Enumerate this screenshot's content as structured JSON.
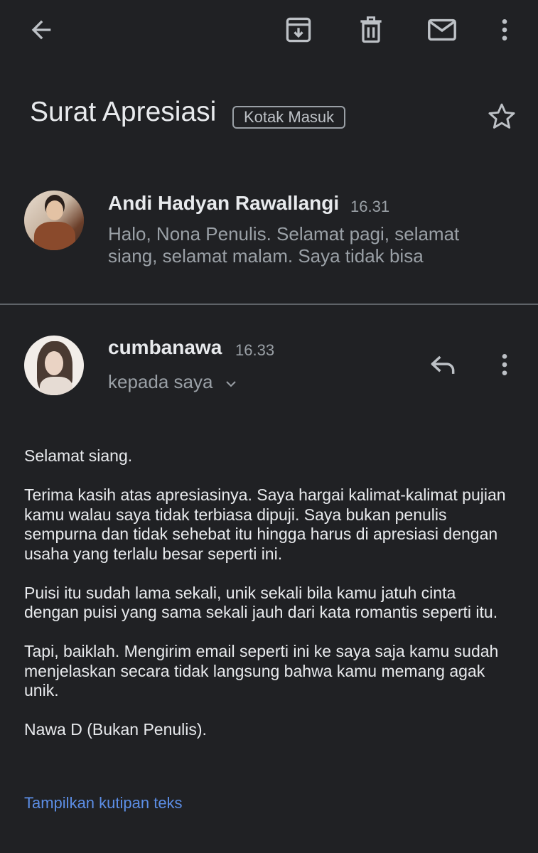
{
  "toolbar": {
    "back_icon": "arrow-back-icon",
    "archive_icon": "archive-icon",
    "delete_icon": "trash-icon",
    "mark_unread_icon": "mail-icon",
    "more_icon": "more-vert-icon"
  },
  "subject": {
    "title": "Surat Apresiasi",
    "label": "Kotak Masuk",
    "star_icon": "star-outline-icon"
  },
  "messages": [
    {
      "sender": "Andi Hadyan Rawallangi",
      "time": "16.31",
      "snippet": "Halo, Nona Penulis. Selamat pagi, selamat siang, selamat malam. Saya tidak bisa"
    },
    {
      "sender": "cumbanawa",
      "time": "16.33",
      "recipient": "kepada saya",
      "body": [
        "Selamat siang.",
        "Terima kasih atas apresiasinya. Saya hargai kalimat-kalimat pujian kamu walau saya tidak terbiasa dipuji. Saya bukan penulis sempurna dan tidak sehebat itu hingga harus di apresiasi dengan usaha yang terlalu besar seperti ini.",
        "Puisi itu sudah lama sekali, unik sekali bila kamu jatuh cinta dengan puisi yang sama sekali jauh dari kata romantis seperti itu.",
        "Tapi, baiklah. Mengirim email seperti ini ke saya saja kamu sudah menjelaskan secara tidak langsung bahwa kamu memang agak unik.",
        "Nawa D (Bukan Penulis)."
      ],
      "show_quoted": "Tampilkan kutipan teks"
    }
  ],
  "colors": {
    "background": "#202124",
    "text_primary": "#e8eaed",
    "text_secondary": "#9aa0a6",
    "link": "#5c8ee6",
    "divider": "#5f6368"
  }
}
